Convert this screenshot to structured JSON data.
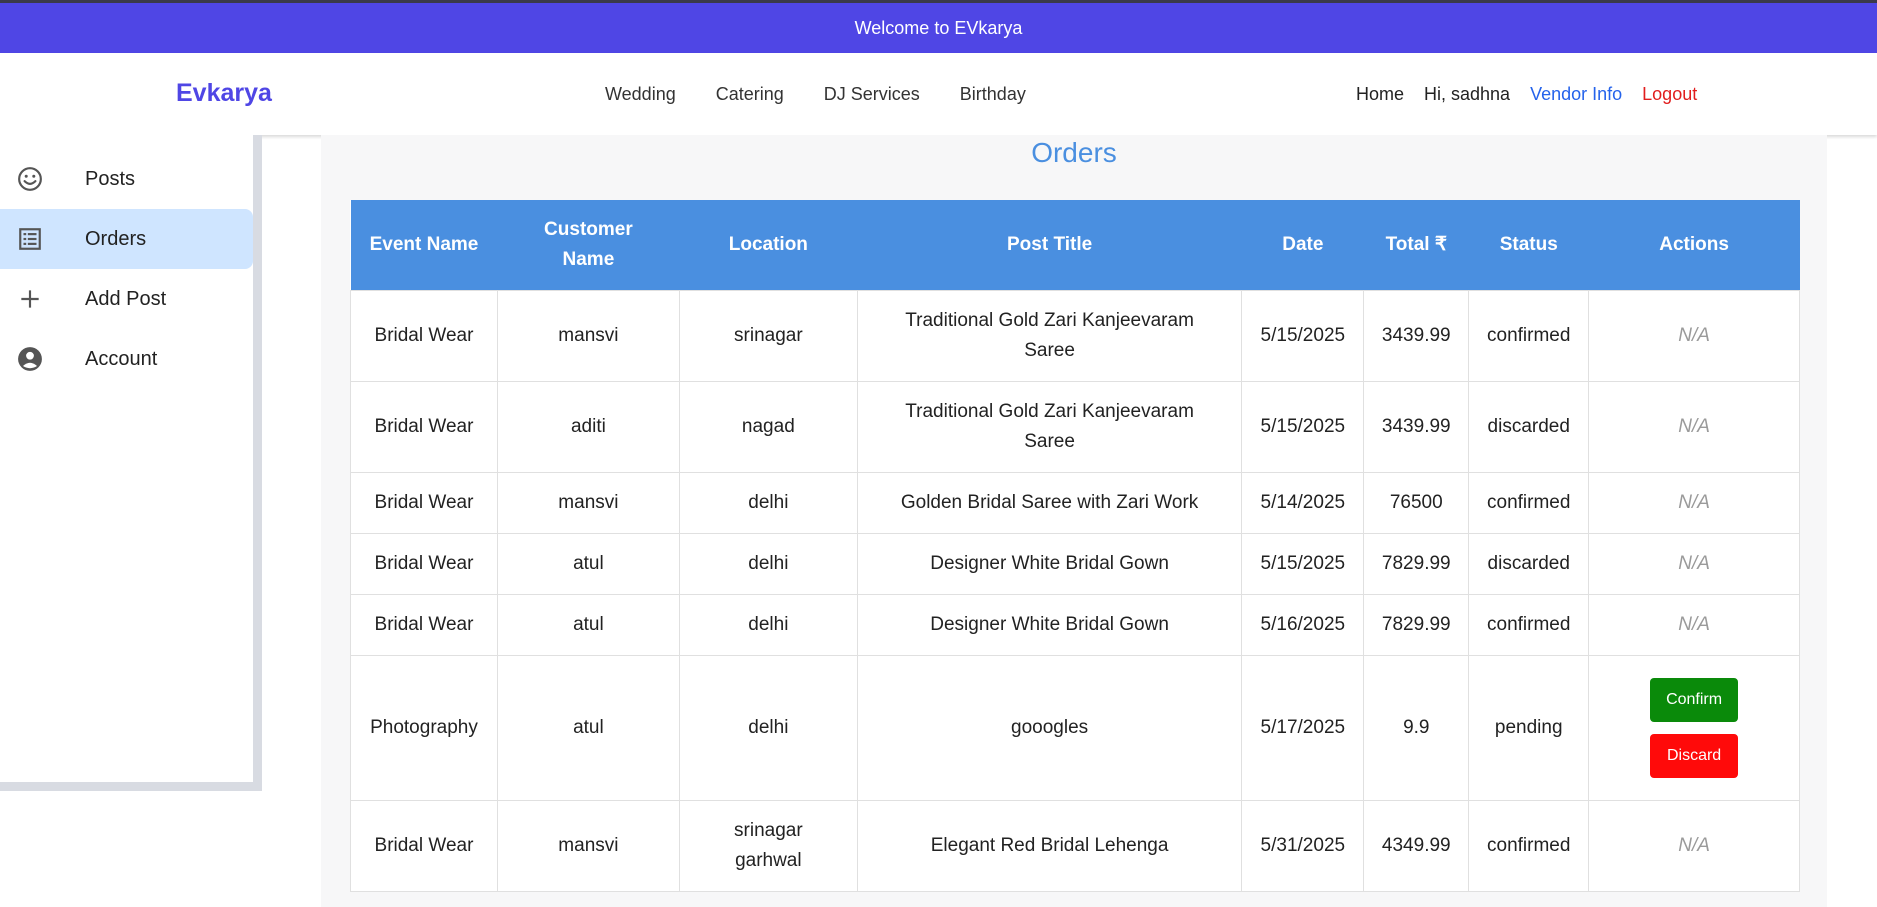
{
  "banner": {
    "text": "Welcome to EVkarya"
  },
  "navbar": {
    "brand": "Evkarya",
    "categories": [
      "Wedding",
      "Catering",
      "DJ Services",
      "Birthday"
    ],
    "home": "Home",
    "greeting": "Hi, sadhna",
    "vendor_info": "Vendor Info",
    "logout": "Logout"
  },
  "sidebar": {
    "items": [
      {
        "label": "Posts",
        "icon": "smiley-icon"
      },
      {
        "label": "Orders",
        "icon": "list-icon",
        "active": true
      },
      {
        "label": "Add Post",
        "icon": "plus-icon"
      },
      {
        "label": "Account",
        "icon": "account-icon"
      }
    ]
  },
  "main": {
    "title": "Orders",
    "columns": [
      "Event Name",
      "Customer Name",
      "Location",
      "Post Title",
      "Date",
      "Total ₹",
      "Status",
      "Actions"
    ],
    "rows": [
      {
        "event": "Bridal Wear",
        "customer": "mansvi",
        "location": "srinagar",
        "post": "Traditional Gold Zari Kanjeevaram Saree",
        "date": "5/15/2025",
        "total": "3439.99",
        "status": "confirmed",
        "action": "N/A"
      },
      {
        "event": "Bridal Wear",
        "customer": "aditi",
        "location": "nagad",
        "post": "Traditional Gold Zari Kanjeevaram Saree",
        "date": "5/15/2025",
        "total": "3439.99",
        "status": "discarded",
        "action": "N/A"
      },
      {
        "event": "Bridal Wear",
        "customer": "mansvi",
        "location": "delhi",
        "post": "Golden Bridal Saree with Zari Work",
        "date": "5/14/2025",
        "total": "76500",
        "status": "confirmed",
        "action": "N/A"
      },
      {
        "event": "Bridal Wear",
        "customer": "atul",
        "location": "delhi",
        "post": "Designer White Bridal Gown",
        "date": "5/15/2025",
        "total": "7829.99",
        "status": "discarded",
        "action": "N/A"
      },
      {
        "event": "Bridal Wear",
        "customer": "atul",
        "location": "delhi",
        "post": "Designer White Bridal Gown",
        "date": "5/16/2025",
        "total": "7829.99",
        "status": "confirmed",
        "action": "N/A"
      },
      {
        "event": "Photography",
        "customer": "atul",
        "location": "delhi",
        "post": "gooogles",
        "date": "5/17/2025",
        "total": "9.9",
        "status": "pending",
        "confirm_label": "Confirm",
        "discard_label": "Discard"
      },
      {
        "event": "Bridal Wear",
        "customer": "mansvi",
        "location": "srinagar garhwal",
        "post": "Elegant Red Bridal Lehenga",
        "date": "5/31/2025",
        "total": "4349.99",
        "status": "confirmed",
        "action": "N/A"
      }
    ]
  },
  "colors": {
    "banner": "#4f46e5",
    "brand": "#4f46e5",
    "table_header": "#4a8fe0",
    "confirm": "#0a8a0a",
    "discard": "#ff0a0a",
    "vendor_info": "#2563eb",
    "logout": "#e11d1d",
    "active_sidebar": "#cfe5ff"
  }
}
